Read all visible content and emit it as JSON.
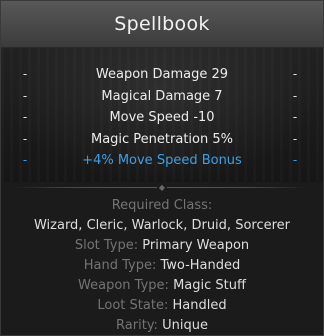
{
  "item": {
    "name": "Spellbook"
  },
  "stats": [
    {
      "text": "Weapon Damage 29",
      "kind": "normal"
    },
    {
      "text": "Magical Damage 7",
      "kind": "normal"
    },
    {
      "text": "Move Speed -10",
      "kind": "normal"
    },
    {
      "text": "Magic Penetration 5%",
      "kind": "normal"
    },
    {
      "text": "+4% Move Speed Bonus",
      "kind": "bonus"
    }
  ],
  "dash": "-",
  "divider_glyph": "◆",
  "requirements": {
    "label": "Required Class:",
    "classes": "Wizard, Cleric, Warlock, Druid, Sorcerer"
  },
  "properties": {
    "slot_type": {
      "label": "Slot Type:",
      "value": "Primary Weapon"
    },
    "hand_type": {
      "label": "Hand Type:",
      "value": "Two-Handed"
    },
    "weapon_type": {
      "label": "Weapon Type:",
      "value": "Magic Stuff"
    },
    "loot_state": {
      "label": "Loot State:",
      "value": "Handled"
    },
    "rarity": {
      "label": "Rarity:",
      "value": "Unique"
    }
  },
  "colors": {
    "bonus": "#3ea0e8",
    "label": "#747474",
    "value": "#dedede",
    "header": "#484848"
  }
}
